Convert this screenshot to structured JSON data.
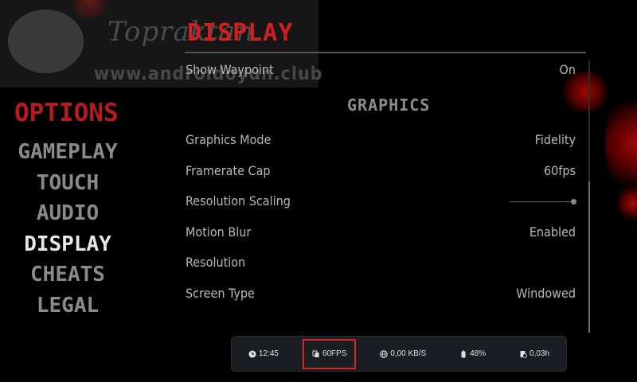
{
  "watermark": {
    "brand": "Topraktan",
    "url": "www.androidoyun.club"
  },
  "page_title": "DISPLAY",
  "options_title": "OPTIONS",
  "menu": [
    {
      "label": "GAMEPLAY",
      "active": false
    },
    {
      "label": "TOUCH",
      "active": false
    },
    {
      "label": "AUDIO",
      "active": false
    },
    {
      "label": "DISPLAY",
      "active": true
    },
    {
      "label": "CHEATS",
      "active": false
    },
    {
      "label": "LEGAL",
      "active": false
    }
  ],
  "settings": {
    "show_waypoint": {
      "label": "Show Waypoint",
      "value": "On"
    },
    "graphics_heading": "GRAPHICS",
    "graphics_mode": {
      "label": "Graphics Mode",
      "value": "Fidelity"
    },
    "framerate_cap": {
      "label": "Framerate Cap",
      "value": "60fps"
    },
    "resolution_scaling": {
      "label": "Resolution Scaling",
      "level": 1.0
    },
    "motion_blur": {
      "label": "Motion Blur",
      "value": "Enabled"
    },
    "resolution": {
      "label": "Resolution",
      "value": ""
    },
    "screen_type": {
      "label": "Screen Type",
      "value": "Windowed"
    }
  },
  "status_bar": {
    "time": "12:45",
    "fps": "60FPS",
    "network": "0,00 KB/S",
    "battery": "48%",
    "playtime": "0,03h"
  },
  "colors": {
    "accent_red": "#d01f1f",
    "menu_inactive": "#8a8a8a",
    "menu_active": "#e6e6e6",
    "highlight_box": "#d7262a",
    "status_bg": "#1a1d21"
  },
  "icons": [
    "clock-icon",
    "fps-icon",
    "globe-icon",
    "battery-icon",
    "playtime-icon"
  ]
}
